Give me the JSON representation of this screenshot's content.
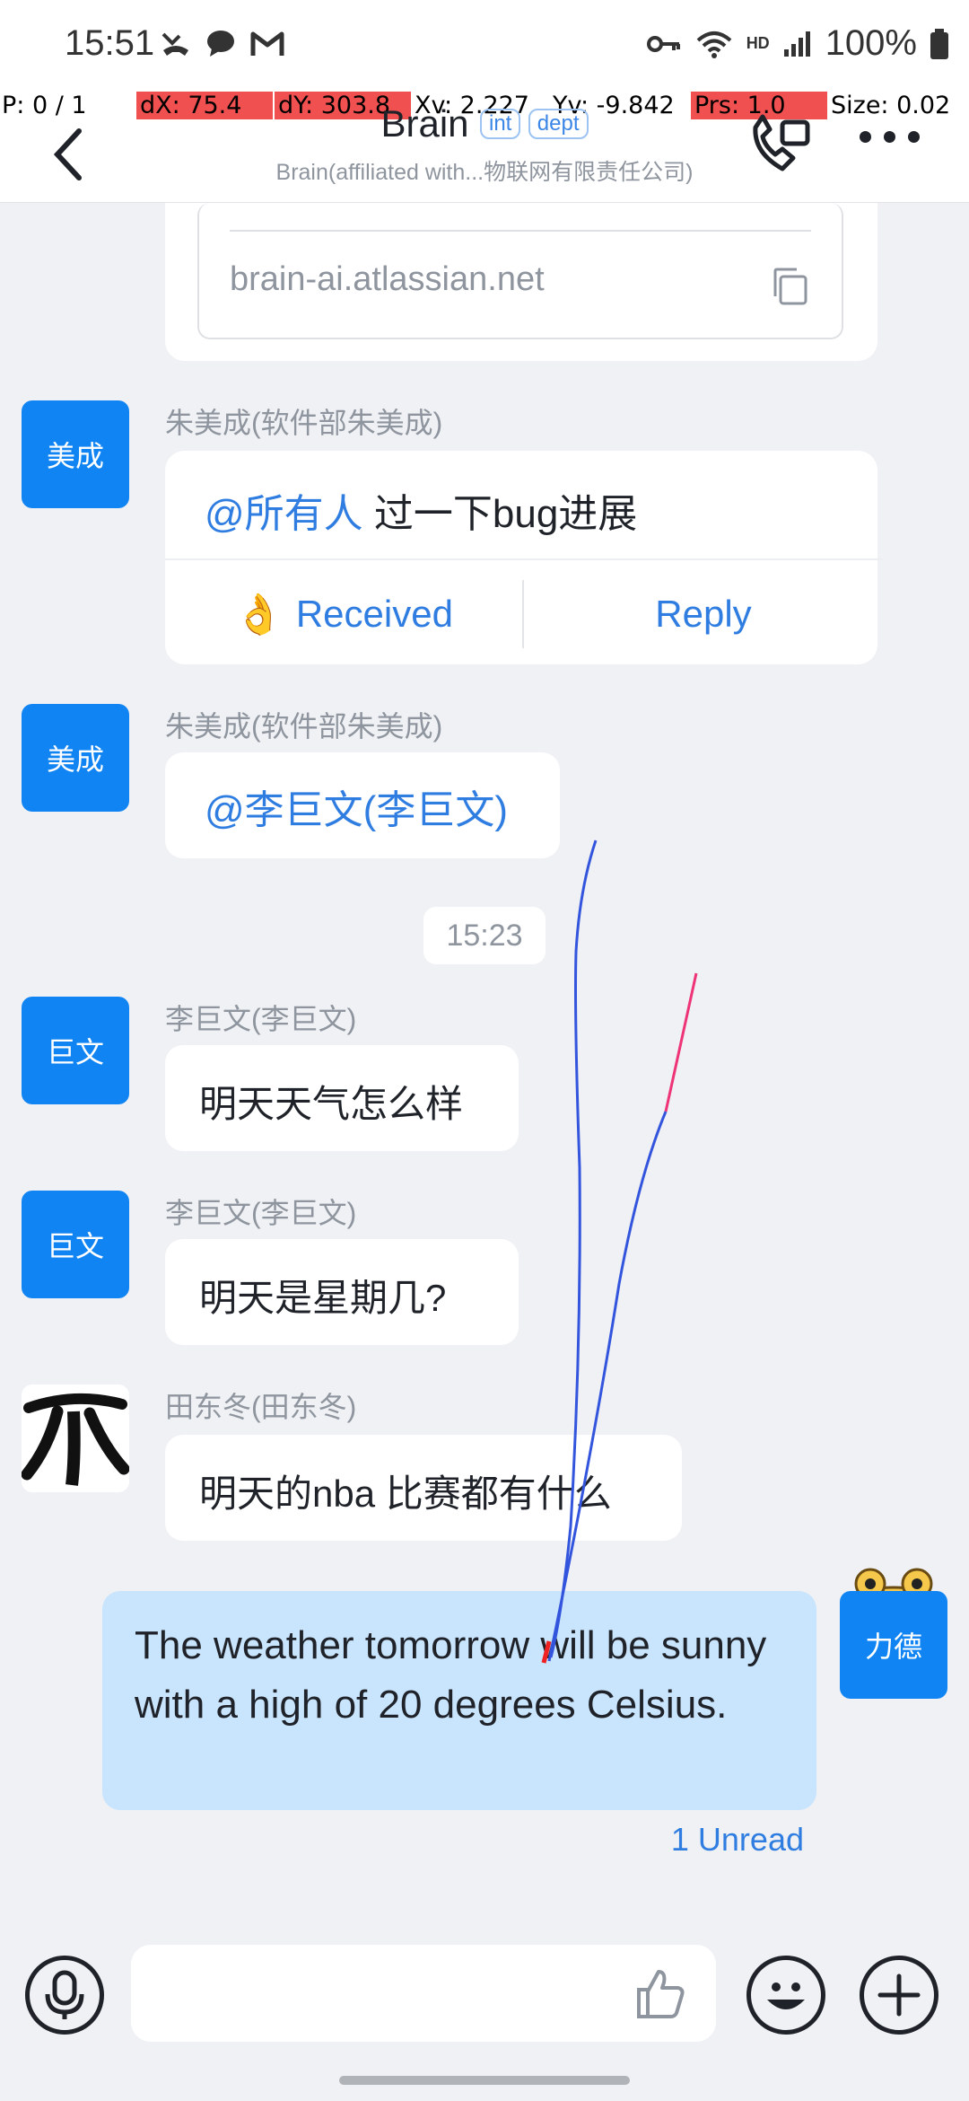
{
  "status_bar": {
    "time": "15:51",
    "battery": "100%",
    "network_badge": "HD"
  },
  "debug_overlay": {
    "p": "P: 0 / 1",
    "dx": "dX: 75.4",
    "dy": "dY: 303.8",
    "xv": "Xv: 2.227",
    "yv": "Yv: -9.842",
    "prs": "Prs: 1.0",
    "size": "Size: 0.02"
  },
  "header": {
    "title": "Brain",
    "tag_int": "int",
    "tag_dept": "dept",
    "subtitle": "Brain(affiliated with...物联网有限责任公司)"
  },
  "link_card": {
    "url": "brain-ai.atlassian.net"
  },
  "messages": [
    {
      "avatar": "美成",
      "sender": "朱美成(软件部朱美成)",
      "mention": "@所有人",
      "text": " 过一下bug进展",
      "received_label": "Received",
      "reply_label": "Reply"
    },
    {
      "avatar": "美成",
      "sender": "朱美成(软件部朱美成)",
      "mention": "@李巨文(李巨文)"
    },
    {
      "avatar": "巨文",
      "sender": "李巨文(李巨文)",
      "text": "明天天气怎么样"
    },
    {
      "avatar": "巨文",
      "sender": "李巨文(李巨文)",
      "text": "明天是星期几?"
    },
    {
      "sender": "田东冬(田东冬)",
      "text": "明天的nba 比赛都有什么"
    }
  ],
  "timestamp": "15:23",
  "my_message": {
    "avatar": "力德",
    "text": "The weather tomorrow will be sunny with a high of 20 degrees Celsius.",
    "unread": "1 Unread"
  },
  "input": {
    "placeholder": ""
  },
  "colors": {
    "accent": "#1084f3",
    "link": "#2f7de1",
    "outgoing_bubble": "#c9e4fd",
    "background": "#eff1f4"
  }
}
